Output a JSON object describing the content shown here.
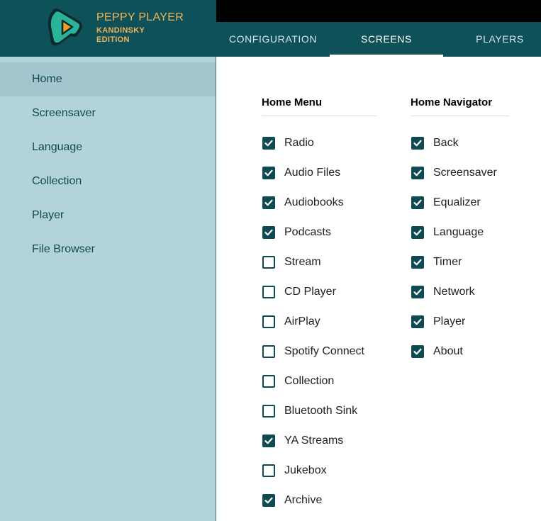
{
  "app": {
    "title": "PEPPY PLAYER",
    "subtitle_1": "KANDINSKY",
    "subtitle_2": "EDITION",
    "logo_icon": "peppy-play-logo"
  },
  "tabs": [
    {
      "label": "CONFIGURATION",
      "active": false
    },
    {
      "label": "SCREENS",
      "active": true
    },
    {
      "label": "PLAYERS",
      "active": false
    }
  ],
  "sidebar": {
    "items": [
      {
        "label": "Home",
        "selected": true
      },
      {
        "label": "Screensaver",
        "selected": false
      },
      {
        "label": "Language",
        "selected": false
      },
      {
        "label": "Collection",
        "selected": false
      },
      {
        "label": "Player",
        "selected": false
      },
      {
        "label": "File Browser",
        "selected": false
      }
    ]
  },
  "home_menu": {
    "title": "Home Menu",
    "items": [
      {
        "label": "Radio",
        "checked": true
      },
      {
        "label": "Audio Files",
        "checked": true
      },
      {
        "label": "Audiobooks",
        "checked": true
      },
      {
        "label": "Podcasts",
        "checked": true
      },
      {
        "label": "Stream",
        "checked": false
      },
      {
        "label": "CD Player",
        "checked": false
      },
      {
        "label": "AirPlay",
        "checked": false
      },
      {
        "label": "Spotify Connect",
        "checked": false
      },
      {
        "label": "Collection",
        "checked": false
      },
      {
        "label": "Bluetooth Sink",
        "checked": false
      },
      {
        "label": "YA Streams",
        "checked": true
      },
      {
        "label": "Jukebox",
        "checked": false
      },
      {
        "label": "Archive",
        "checked": true
      }
    ]
  },
  "home_navigator": {
    "title": "Home Navigator",
    "items": [
      {
        "label": "Back",
        "checked": true
      },
      {
        "label": "Screensaver",
        "checked": true
      },
      {
        "label": "Equalizer",
        "checked": true
      },
      {
        "label": "Language",
        "checked": true
      },
      {
        "label": "Timer",
        "checked": true
      },
      {
        "label": "Network",
        "checked": true
      },
      {
        "label": "Player",
        "checked": true
      },
      {
        "label": "About",
        "checked": true
      }
    ]
  },
  "colors": {
    "header_bg": "#0f5159",
    "sidebar_bg": "#b3d3db",
    "sidebar_selected_bg": "#a3c5cd",
    "accent": "#0f4a52",
    "logo_text": "#f0b458",
    "logo_green": "#2bb39a",
    "logo_orange": "#f39c1f"
  }
}
